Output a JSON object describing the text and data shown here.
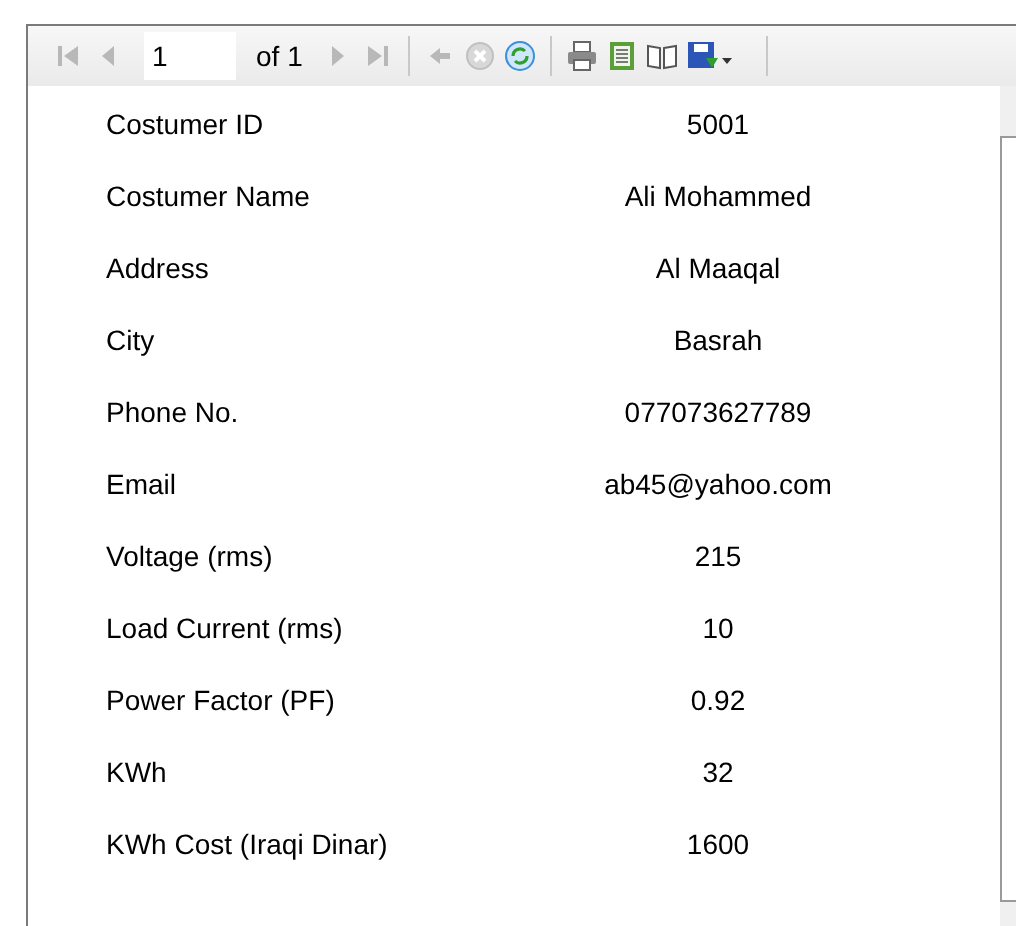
{
  "toolbar": {
    "page_number": "1",
    "page_count": "of 1"
  },
  "fields": [
    {
      "label": "Costumer ID",
      "value": "5001"
    },
    {
      "label": "Costumer Name",
      "value": "Ali Mohammed"
    },
    {
      "label": "Address",
      "value": "Al Maaqal"
    },
    {
      "label": "City",
      "value": "Basrah"
    },
    {
      "label": "Phone No.",
      "value": "077073627789"
    },
    {
      "label": "Email",
      "value": "ab45@yahoo.com"
    },
    {
      "label": "Voltage (rms)",
      "value": "215"
    },
    {
      "label": "Load Current (rms)",
      "value": "10"
    },
    {
      "label": "Power Factor (PF)",
      "value": "0.92"
    },
    {
      "label": "KWh",
      "value": "32"
    },
    {
      "label": "KWh Cost (Iraqi Dinar)",
      "value": "1600"
    }
  ]
}
